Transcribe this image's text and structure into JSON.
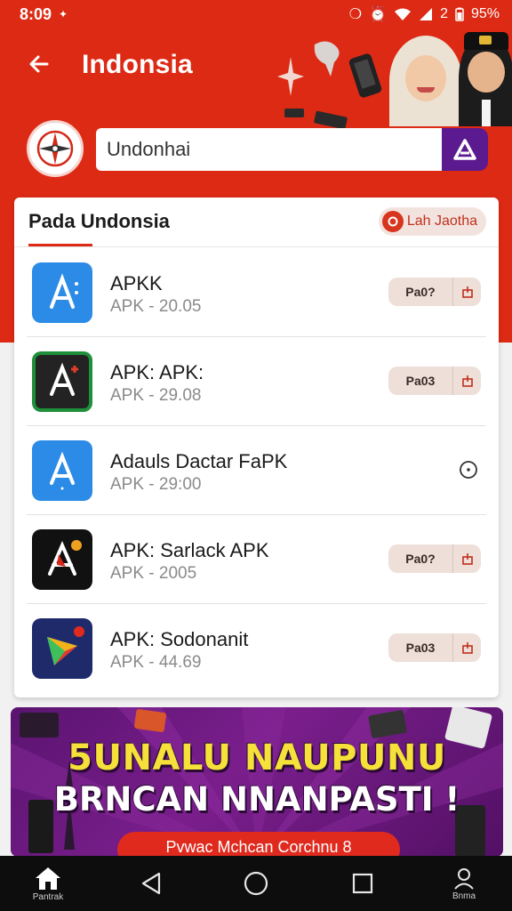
{
  "status_bar": {
    "time": "8:09",
    "signal": "2",
    "battery": "95%"
  },
  "header": {
    "title": "Indonsia"
  },
  "search": {
    "value": "Undonhai"
  },
  "card": {
    "title": "Pada Undonsia",
    "lang_button": "Lah Jaotha"
  },
  "apps": [
    {
      "name": "APKK",
      "meta": "APK - 20.05",
      "action": "Pa0?",
      "icon": "app-store-icon",
      "color": "#2c8be6"
    },
    {
      "name": "APK: APK:",
      "meta": "APK - 29.08",
      "action": "Pa03",
      "icon": "apk-plus-icon",
      "color": "#232323"
    },
    {
      "name": "Adauls Dactar FaPK",
      "meta": "APK - 29:00",
      "action": "",
      "icon": "app-store-icon",
      "color": "#2c8be6"
    },
    {
      "name": "APK: Sarlack APK",
      "meta": "APK - 2005",
      "action": "Pa0?",
      "icon": "apk-dark-icon",
      "color": "#111111"
    },
    {
      "name": "APK: Sodonanit",
      "meta": "APK - 44.69",
      "action": "Pa03",
      "icon": "play-store-icon",
      "color": "#1f2a6b"
    }
  ],
  "banner": {
    "line1": "5UNALU NAUPUNU",
    "line2": "BRNCAN NNANPASTI !",
    "cta": "Pvwac Mchcan Corchnu 8"
  },
  "navbar": {
    "home_label": "Pantrak",
    "account_label": "Bnma"
  },
  "colors": {
    "accent": "#dd2a14",
    "search_button": "#5b1a8f",
    "banner_bg": "#6d1a80"
  }
}
